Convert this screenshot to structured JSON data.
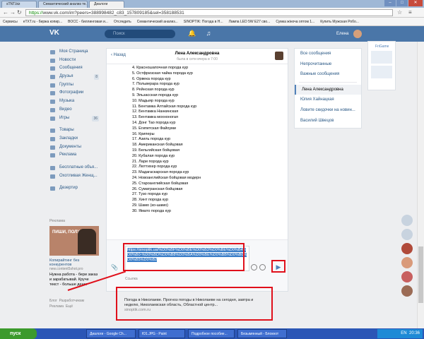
{
  "browser": {
    "tabs": [
      {
        "label": "sTNT.biz"
      },
      {
        "label": "Семантический анализ те..."
      },
      {
        "label": "Диалоги"
      }
    ],
    "url_scheme": "https://",
    "url_rest": "www.vk.com/im?peers=388998482_c83_157809185&sel=358188531",
    "bookmarks": [
      "Сервисы",
      "eTXT.ru - биржа копир...",
      "BOCC - биллинговая и...",
      "Отследить",
      "Семантический анализ...",
      "SINOPTIK: Погода в Н...",
      "Лампа LED 5W E27 сво...",
      "Сумка жіноча оптом 1...",
      "Купить Мужская Робо..."
    ]
  },
  "vk": {
    "search_placeholder": "Поиск",
    "user_name": "Елена",
    "sidebar": [
      {
        "label": "Моя Страница",
        "count": ""
      },
      {
        "label": "Новости",
        "count": ""
      },
      {
        "label": "Сообщения",
        "count": ""
      },
      {
        "label": "Друзья",
        "count": "8"
      },
      {
        "label": "Группы",
        "count": ""
      },
      {
        "label": "Фотографии",
        "count": ""
      },
      {
        "label": "Музыка",
        "count": ""
      },
      {
        "label": "Видео",
        "count": ""
      },
      {
        "label": "Игры",
        "count": "36"
      }
    ],
    "sidebar2": [
      {
        "label": "Товары"
      },
      {
        "label": "Закладки"
      },
      {
        "label": "Документы"
      },
      {
        "label": "Реклама"
      }
    ],
    "sidebar3": [
      {
        "label": "Бесплатные объя..."
      },
      {
        "label": "Охотливая Женщ..."
      }
    ],
    "sidebar4": [
      {
        "label": "Дезертир"
      }
    ],
    "ad": {
      "label": "Реклама",
      "image_text": "ПИШИ, ПОЛУЧАЙ",
      "title": "Копирайтинг без конкурентов",
      "site": "new.content5shot.pro",
      "body": "Нужна работа - бери заказ и зарабатывай. Круче текст - больше денег"
    },
    "footer": [
      "Блог",
      "Разработчикам",
      "Реклама",
      "Ещё"
    ],
    "chat": {
      "back_label": "Назад",
      "name": "Лена Александровна",
      "status": "была в сети вчера в 7:00",
      "messages": [
        "4. Красношапочная порода кур",
        "5. Остфризская чайка порода кур",
        "6. Орвека порода кур",
        "7. Польверара порода кур",
        "8. Рейнская порода кур",
        "9. Эльзасская порода кур",
        "10. Мадыяр порода кур",
        "11. Бентамка Алтайская порода кур",
        "12. Бентамка Нанкинская",
        "13. Бентамка мохноногая",
        "14. Донг Тао порода кур",
        "15. Египетская Файоуми",
        "16. Криперы",
        "17. Азиль порода кур",
        "18. Американская бойцовая",
        "19. Бельгийская бойцовая",
        "20. Кубалая порода кур",
        "21. Лари порода кур",
        "22. Люттихер порода кур",
        "23. Мадагаскарская порода кур",
        "24. Новоанглийская бойцовая модерн",
        "25. Староанглийская бойцовая",
        "26. Суматранская бойцовая",
        "27. Тузо порода кур",
        "28. Хинт порода кур",
        "29. Шамо (ко-шамо)",
        "30. Ямато порода кур"
      ],
      "input_text": "https://sinoptik.ua/%D0%BF%D0%BE%D0%B3%D0%BE%D0%B4%D0%B0-%D0%BD%D0%B8%D0%BA%D0%BE%D0%BB%D0%B0%D0%B5%D0%B2",
      "preview": {
        "header": "Ссылка",
        "title": "Погода в Николаеве. Прогноз погоды в Николаеве на сегодня, завтра и неделю, Николаевская область, Областной центр...",
        "site": "sinoptik.com.ru"
      }
    },
    "right_panel": {
      "filters": [
        "Все сообщения",
        "Непрочитанные",
        "Важные сообщения"
      ],
      "dialogs": [
        "Лена Александровна",
        "Юлия Хайнацкая",
        "Ловите скидочки на новин...",
        "Василий Швецов"
      ]
    },
    "friends_widget": {
      "title": "FriGame"
    }
  },
  "taskbar": {
    "start": "пуск",
    "items": [
      "Диалоги - Google Ch...",
      "Ю1.JPG - Paint",
      "Подробное пособие...",
      "Безымянный - Блокнот"
    ],
    "clock": "20:36",
    "lang": "EN"
  },
  "colors": {
    "vk_blue": "#4a76a8",
    "highlight_red": "#e0101b",
    "selection_blue": "#3b7ec8"
  }
}
